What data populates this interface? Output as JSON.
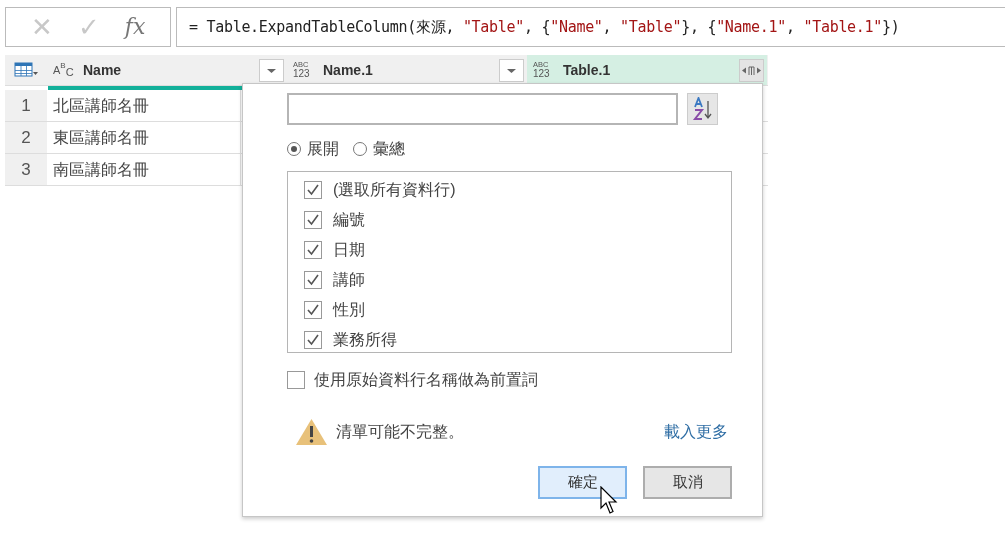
{
  "formula_bar": {
    "cancel": "✕",
    "confirm": "✓",
    "fx": "fx",
    "formula": [
      {
        "kind": "code",
        "text": "= Table.ExpandTableColumn(來源, "
      },
      {
        "kind": "string",
        "text": "\"Table\""
      },
      {
        "kind": "code",
        "text": ", {"
      },
      {
        "kind": "string",
        "text": "\"Name\""
      },
      {
        "kind": "code",
        "text": ", "
      },
      {
        "kind": "string",
        "text": "\"Table\""
      },
      {
        "kind": "code",
        "text": "}, {"
      },
      {
        "kind": "string",
        "text": "\"Name.1\""
      },
      {
        "kind": "code",
        "text": ", "
      },
      {
        "kind": "string",
        "text": "\"Table.1\""
      },
      {
        "kind": "code",
        "text": "})"
      }
    ]
  },
  "table": {
    "columns": [
      {
        "name": "Name",
        "type_badge": {
          "kind": "text",
          "parts": [
            "A",
            "B",
            "C"
          ]
        },
        "selected": false
      },
      {
        "name": "Name.1",
        "type_badge": {
          "kind": "any",
          "parts": [
            "ABC",
            "123"
          ]
        },
        "selected": false
      },
      {
        "name": "Table.1",
        "type_badge": {
          "kind": "any",
          "parts": [
            "ABC",
            "123"
          ]
        },
        "selected": true
      }
    ],
    "rows": [
      {
        "number": "1",
        "name": "北區講師名冊"
      },
      {
        "number": "2",
        "name": "東區講師名冊"
      },
      {
        "number": "3",
        "name": "南區講師名冊"
      }
    ]
  },
  "expand_popup": {
    "modes": [
      {
        "label": "展開",
        "selected": true
      },
      {
        "label": "彙總",
        "selected": false
      }
    ],
    "columns": [
      {
        "label": "(選取所有資料行)",
        "checked": true
      },
      {
        "label": "編號",
        "checked": true
      },
      {
        "label": "日期",
        "checked": true
      },
      {
        "label": "講師",
        "checked": true
      },
      {
        "label": "性別",
        "checked": true
      },
      {
        "label": "業務所得",
        "checked": true
      }
    ],
    "prefix_option": {
      "label": "使用原始資料行名稱做為前置詞",
      "checked": false
    },
    "warning": "清單可能不完整。",
    "load_more": "載入更多",
    "buttons": [
      {
        "label": "確定",
        "kind": "primary"
      },
      {
        "label": "取消",
        "kind": "secondary"
      }
    ]
  }
}
